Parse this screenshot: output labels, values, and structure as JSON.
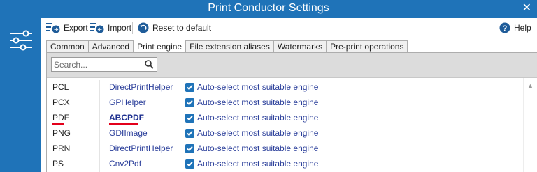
{
  "window": {
    "title": "Print Conductor Settings",
    "close_glyph": "✕"
  },
  "toolbar": {
    "export_label": "Export",
    "import_label": "Import",
    "reset_label": "Reset to default",
    "help_label": "Help"
  },
  "tabs": [
    "Common",
    "Advanced",
    "Print engine",
    "File extension aliases",
    "Watermarks",
    "Pre-print operations"
  ],
  "active_tab": "Print engine",
  "search": {
    "placeholder": "Search..."
  },
  "engines": [
    {
      "format": "PCL",
      "engine": "DirectPrintHelper",
      "auto_label": "Auto-select most suitable engine",
      "checked": true
    },
    {
      "format": "PCX",
      "engine": "GPHelper",
      "auto_label": "Auto-select most suitable engine",
      "checked": true
    },
    {
      "format": "PDF",
      "engine": "ABCPDF",
      "auto_label": "Auto-select most suitable engine",
      "checked": true,
      "highlighted": true
    },
    {
      "format": "PNG",
      "engine": "GDIImage",
      "auto_label": "Auto-select most suitable engine",
      "checked": true
    },
    {
      "format": "PRN",
      "engine": "DirectPrintHelper",
      "auto_label": "Auto-select most suitable engine",
      "checked": true
    },
    {
      "format": "PS",
      "engine": "Cnv2Pdf",
      "auto_label": "Auto-select most suitable engine",
      "checked": true
    }
  ],
  "colors": {
    "accent": "#1f73b8",
    "link_text": "#2a3e9a",
    "highlight_underline": "#e3001b"
  },
  "icons": [
    "close-icon",
    "settings-sliders-icon",
    "export-icon",
    "import-icon",
    "reset-icon",
    "help-icon",
    "search-icon",
    "checkbox-check-icon",
    "scroll-up-icon"
  ]
}
